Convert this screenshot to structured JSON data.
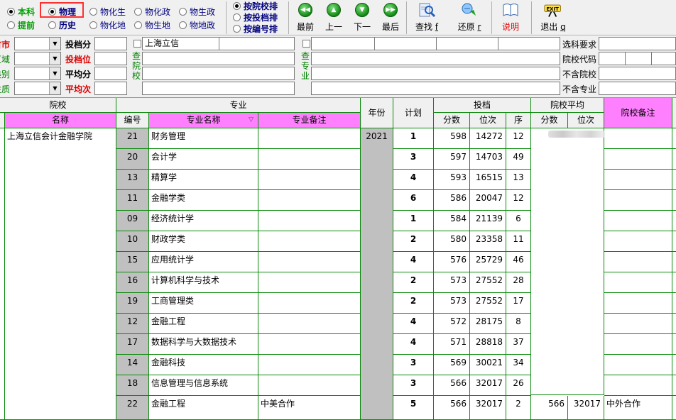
{
  "toolbar": {
    "level": [
      {
        "label": "本科",
        "selected": true
      },
      {
        "label": "提前",
        "selected": false
      }
    ],
    "subjects": [
      {
        "label": "物理",
        "selected": true
      },
      {
        "label": "历史",
        "selected": false
      },
      {
        "label": "物化生",
        "selected": false
      },
      {
        "label": "物化地",
        "selected": false
      },
      {
        "label": "物化政",
        "selected": false
      },
      {
        "label": "物生地",
        "selected": false
      },
      {
        "label": "物生政",
        "selected": false
      },
      {
        "label": "物地政",
        "selected": false
      }
    ],
    "sort": [
      {
        "label": "按院校排",
        "selected": true
      },
      {
        "label": "按投档排",
        "selected": false
      },
      {
        "label": "按编号排",
        "selected": false
      }
    ],
    "buttons": {
      "first": "最前",
      "prev": "上一",
      "next": "下一",
      "last": "最后",
      "find": "查找",
      "find_key": "f",
      "restore": "还原",
      "restore_key": "r",
      "help": "说明",
      "exit": "退出",
      "exit_key": "q"
    }
  },
  "filters": {
    "left_labels": [
      "省市",
      "区域",
      "类别",
      "性质"
    ],
    "score_labels": [
      "投档分",
      "投档位",
      "平均分",
      "平均次"
    ],
    "query_school_label": "查院校",
    "school_name_value": "上海立信",
    "query_major_label": "查专业",
    "right_labels": [
      "选科要求",
      "院校代码",
      "不含院校",
      "不含专业"
    ]
  },
  "grid": {
    "headers": {
      "school_group": "院校",
      "school_name": "名称",
      "major_group": "专业",
      "code": "编号",
      "major_name": "专业名称",
      "major_note": "专业备注",
      "year": "年份",
      "plan": "计划",
      "toudang_group": "投档",
      "score": "分数",
      "rank": "位次",
      "order": "序",
      "avg_group": "院校平均",
      "avg_score": "分数",
      "avg_rank": "位次",
      "school_note": "院校备注"
    },
    "school_name": "上海立信会计金融学院",
    "year": "2021",
    "rows": [
      {
        "code": "21",
        "major": "财务管理",
        "note": "",
        "plan": "1",
        "score": "598",
        "rank": "14272",
        "order": "12",
        "avg_score": "",
        "avg_rank": "",
        "school_note": ""
      },
      {
        "code": "20",
        "major": "会计学",
        "note": "",
        "plan": "3",
        "score": "597",
        "rank": "14703",
        "order": "49",
        "avg_score": "",
        "avg_rank": "",
        "school_note": ""
      },
      {
        "code": "13",
        "major": "精算学",
        "note": "",
        "plan": "4",
        "score": "593",
        "rank": "16515",
        "order": "13",
        "avg_score": "",
        "avg_rank": "",
        "school_note": ""
      },
      {
        "code": "11",
        "major": "金融学类",
        "note": "",
        "plan": "6",
        "score": "586",
        "rank": "20047",
        "order": "12",
        "avg_score": "",
        "avg_rank": "",
        "school_note": ""
      },
      {
        "code": "09",
        "major": "经济统计学",
        "note": "",
        "plan": "1",
        "score": "584",
        "rank": "21139",
        "order": "6",
        "avg_score": "",
        "avg_rank": "",
        "school_note": ""
      },
      {
        "code": "10",
        "major": "财政学类",
        "note": "",
        "plan": "2",
        "score": "580",
        "rank": "23358",
        "order": "11",
        "avg_score": "",
        "avg_rank": "",
        "school_note": ""
      },
      {
        "code": "15",
        "major": "应用统计学",
        "note": "",
        "plan": "4",
        "score": "576",
        "rank": "25729",
        "order": "46",
        "avg_score": "",
        "avg_rank": "",
        "school_note": ""
      },
      {
        "code": "16",
        "major": "计算机科学与技术",
        "note": "",
        "plan": "2",
        "score": "573",
        "rank": "27552",
        "order": "28",
        "avg_score": "",
        "avg_rank": "",
        "school_note": ""
      },
      {
        "code": "19",
        "major": "工商管理类",
        "note": "",
        "plan": "2",
        "score": "573",
        "rank": "27552",
        "order": "17",
        "avg_score": "",
        "avg_rank": "",
        "school_note": ""
      },
      {
        "code": "12",
        "major": "金融工程",
        "note": "",
        "plan": "4",
        "score": "572",
        "rank": "28175",
        "order": "8",
        "avg_score": "",
        "avg_rank": "",
        "school_note": ""
      },
      {
        "code": "17",
        "major": "数据科学与大数据技术",
        "note": "",
        "plan": "4",
        "score": "571",
        "rank": "28818",
        "order": "37",
        "avg_score": "",
        "avg_rank": "",
        "school_note": ""
      },
      {
        "code": "14",
        "major": "金融科技",
        "note": "",
        "plan": "3",
        "score": "569",
        "rank": "30021",
        "order": "34",
        "avg_score": "",
        "avg_rank": "",
        "school_note": ""
      },
      {
        "code": "18",
        "major": "信息管理与信息系统",
        "note": "",
        "plan": "3",
        "score": "566",
        "rank": "32017",
        "order": "26",
        "avg_score": "",
        "avg_rank": "",
        "school_note": ""
      },
      {
        "code": "22",
        "major": "金融工程",
        "note": "中美合作",
        "plan": "5",
        "score": "566",
        "rank": "32017",
        "order": "2",
        "avg_score": "566",
        "avg_rank": "32017",
        "school_note": "中外合作"
      }
    ]
  }
}
